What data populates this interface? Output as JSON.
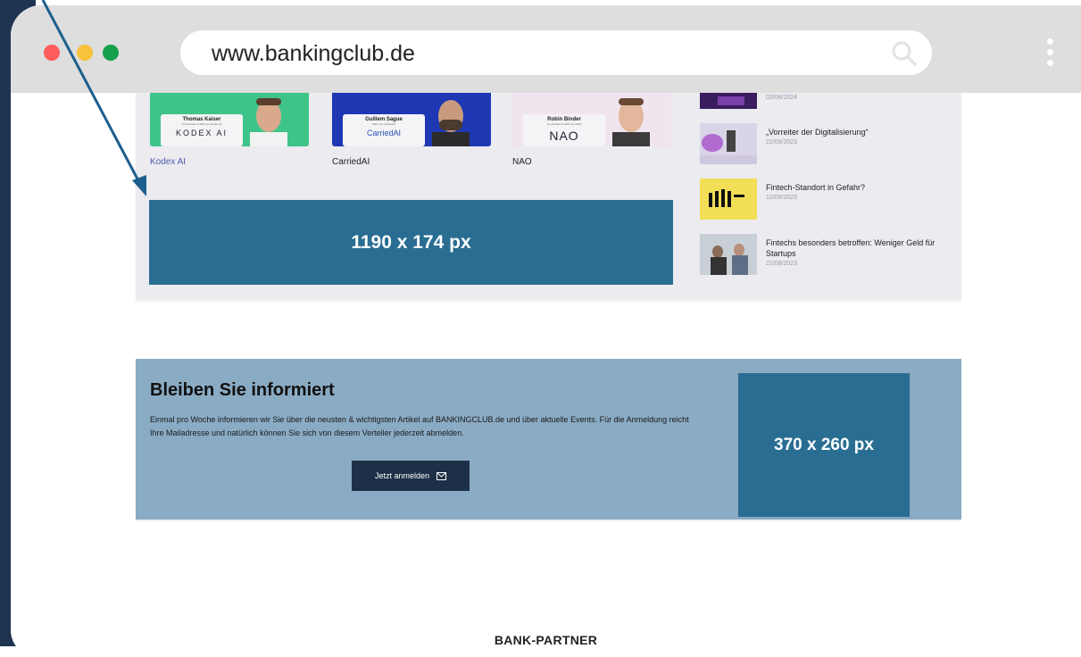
{
  "browser": {
    "url": "www.bankingclub.de",
    "traffic_lights": {
      "close_color": "#ff5c5c",
      "minimize_color": "#f8c23a",
      "maximize_color": "#17a04c"
    },
    "search_icon": "search-icon",
    "menu_icon": "kebab-menu-icon"
  },
  "cards": [
    {
      "name": "Thomas Kaiser",
      "subtitle": "Co-Founder & CEO von Kodex AI",
      "logo": "KODEX AI",
      "caption": "Kodex AI"
    },
    {
      "name": "Guillem Sague",
      "subtitle": "CEO von CarriedAI",
      "logo": "CarriedAI",
      "caption": "CarriedAI"
    },
    {
      "name": "Robin Binder",
      "subtitle": "Co-founder & CEO von NAO",
      "logo": "NAO",
      "caption": "NAO"
    }
  ],
  "ad_banner": {
    "label": "1190 x 174 px",
    "color": "#2a6d93"
  },
  "news": [
    {
      "title": "",
      "date": "02/06/2024"
    },
    {
      "title": "„Vorreiter der Digitalisierung“",
      "date": "22/09/2023"
    },
    {
      "title": "Fintech-Standort in Gefahr?",
      "date": "12/09/2023"
    },
    {
      "title": "Fintechs besonders betroffen: Weniger Geld für Startups",
      "date": "22/08/2023"
    }
  ],
  "newsletter": {
    "title": "Bleiben Sie informiert",
    "text": "Einmal pro Woche informieren wir Sie über die neusten & wichtigsten Artikel auf BANKINGCLUB.de und über aktuelle Events. Für die Anmeldung reicht Ihre Mailadresse und natürlich können Sie sich von diesem Verteiler jederzeit abmelden.",
    "button_label": "Jetzt anmelden",
    "button_icon": "mail-icon",
    "ad_label": "370 x 260 px"
  },
  "footer": {
    "heading": "BANK-PARTNER"
  },
  "colors": {
    "accent": "#2a6d93",
    "dark": "#1e3048",
    "newsletter_bg": "#8aabc4",
    "arrow": "#1c5f8e"
  }
}
